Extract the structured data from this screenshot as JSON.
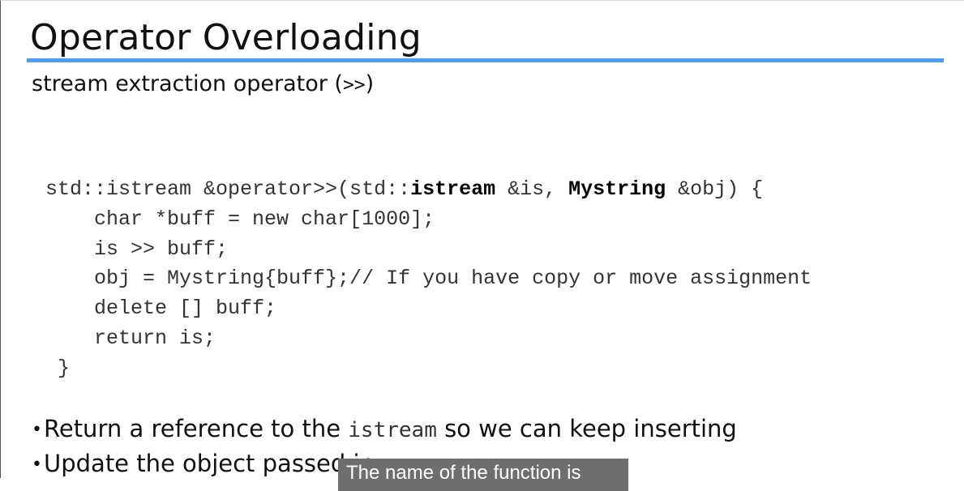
{
  "slide": {
    "title": "Operator Overloading",
    "subtitle_text": "stream extraction operator (",
    "subtitle_operator": ">>",
    "subtitle_close": ")",
    "accent_color": "#4d9ef0"
  },
  "code": {
    "line1": {
      "a": "std::istream &operator>>(std::",
      "b": "istream",
      "c": " &is, ",
      "d": "Mystring",
      "e": " &obj) {"
    },
    "line2": "    char *buff = new char[1000];",
    "line3": "    is >> buff;",
    "line4": "    obj = Mystring{buff};// If you have copy or move assignment",
    "line5": "    delete [] buff;",
    "line6": "    return is;",
    "line7": " }"
  },
  "bullets": {
    "marker": "•",
    "item1": {
      "before": "Return a reference to the ",
      "code": "istream",
      "after": " so we can keep inserting"
    },
    "item2": "Update the object passed in"
  },
  "caption": {
    "text": "The name of the function is",
    "background": "#6e6e6e"
  }
}
